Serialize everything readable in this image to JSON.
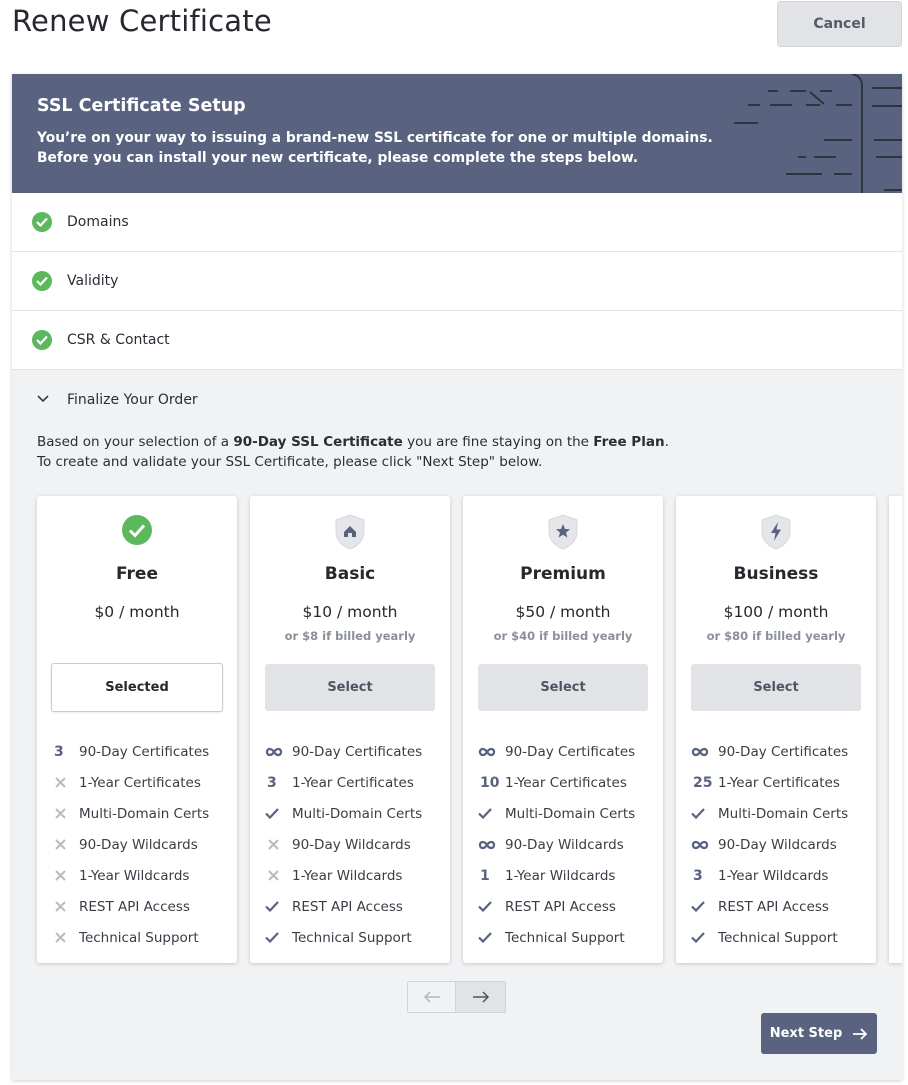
{
  "page": {
    "title": "Renew Certificate",
    "cancel_label": "Cancel"
  },
  "banner": {
    "title": "SSL Certificate Setup",
    "desc_line1": "You’re on your way to issuing a brand-new SSL certificate for one or multiple domains.",
    "desc_line2": "Before you can install your new certificate, please complete the steps below."
  },
  "steps": [
    {
      "label": "Domains",
      "status": "complete"
    },
    {
      "label": "Validity",
      "status": "complete"
    },
    {
      "label": "CSR & Contact",
      "status": "complete"
    }
  ],
  "finalize": {
    "label": "Finalize Your Order",
    "desc_prefix": "Based on your selection of a ",
    "desc_bold1": "90-Day SSL Certificate",
    "desc_mid": " you are fine staying on the ",
    "desc_bold2": "Free Plan",
    "desc_suffix": ".",
    "desc_line2": "To create and validate your SSL Certificate, please click \"Next Step\" below."
  },
  "plans": [
    {
      "name": "Free",
      "price": "$0 / month",
      "yearly": "",
      "button": "Selected",
      "selected": true,
      "icon": "check-circle-icon",
      "features": [
        {
          "mark": "3",
          "label": "90-Day Certificates"
        },
        {
          "mark": "x",
          "label": "1-Year Certificates"
        },
        {
          "mark": "x",
          "label": "Multi-Domain Certs"
        },
        {
          "mark": "x",
          "label": "90-Day Wildcards"
        },
        {
          "mark": "x",
          "label": "1-Year Wildcards"
        },
        {
          "mark": "x",
          "label": "REST API Access"
        },
        {
          "mark": "x",
          "label": "Technical Support"
        }
      ]
    },
    {
      "name": "Basic",
      "price": "$10 / month",
      "yearly": "or $8 if billed yearly",
      "button": "Select",
      "selected": false,
      "icon": "home-shield-icon",
      "features": [
        {
          "mark": "∞",
          "label": "90-Day Certificates"
        },
        {
          "mark": "3",
          "label": "1-Year Certificates"
        },
        {
          "mark": "✓",
          "label": "Multi-Domain Certs"
        },
        {
          "mark": "x",
          "label": "90-Day Wildcards"
        },
        {
          "mark": "x",
          "label": "1-Year Wildcards"
        },
        {
          "mark": "✓",
          "label": "REST API Access"
        },
        {
          "mark": "✓",
          "label": "Technical Support"
        }
      ]
    },
    {
      "name": "Premium",
      "price": "$50 / month",
      "yearly": "or $40 if billed yearly",
      "button": "Select",
      "selected": false,
      "icon": "star-shield-icon",
      "features": [
        {
          "mark": "∞",
          "label": "90-Day Certificates"
        },
        {
          "mark": "10",
          "label": "1-Year Certificates"
        },
        {
          "mark": "✓",
          "label": "Multi-Domain Certs"
        },
        {
          "mark": "∞",
          "label": "90-Day Wildcards"
        },
        {
          "mark": "1",
          "label": "1-Year Wildcards"
        },
        {
          "mark": "✓",
          "label": "REST API Access"
        },
        {
          "mark": "✓",
          "label": "Technical Support"
        }
      ]
    },
    {
      "name": "Business",
      "price": "$100 / month",
      "yearly": "or $80 if billed yearly",
      "button": "Select",
      "selected": false,
      "icon": "lightning-shield-icon",
      "features": [
        {
          "mark": "∞",
          "label": "90-Day Certificates"
        },
        {
          "mark": "25",
          "label": "1-Year Certificates"
        },
        {
          "mark": "✓",
          "label": "Multi-Domain Certs"
        },
        {
          "mark": "∞",
          "label": "90-Day Wildcards"
        },
        {
          "mark": "3",
          "label": "1-Year Wildcards"
        },
        {
          "mark": "✓",
          "label": "REST API Access"
        },
        {
          "mark": "✓",
          "label": "Technical Support"
        }
      ]
    }
  ],
  "pager": {
    "prev_icon": "arrow-left-icon",
    "next_icon": "arrow-right-icon"
  },
  "next_step": {
    "label": "Next Step",
    "icon": "arrow-right-icon"
  },
  "colors": {
    "accent": "#59637f",
    "success": "#5cb85c",
    "button_gray": "#e1e3e7",
    "panel_bg": "#f1f2f4"
  }
}
